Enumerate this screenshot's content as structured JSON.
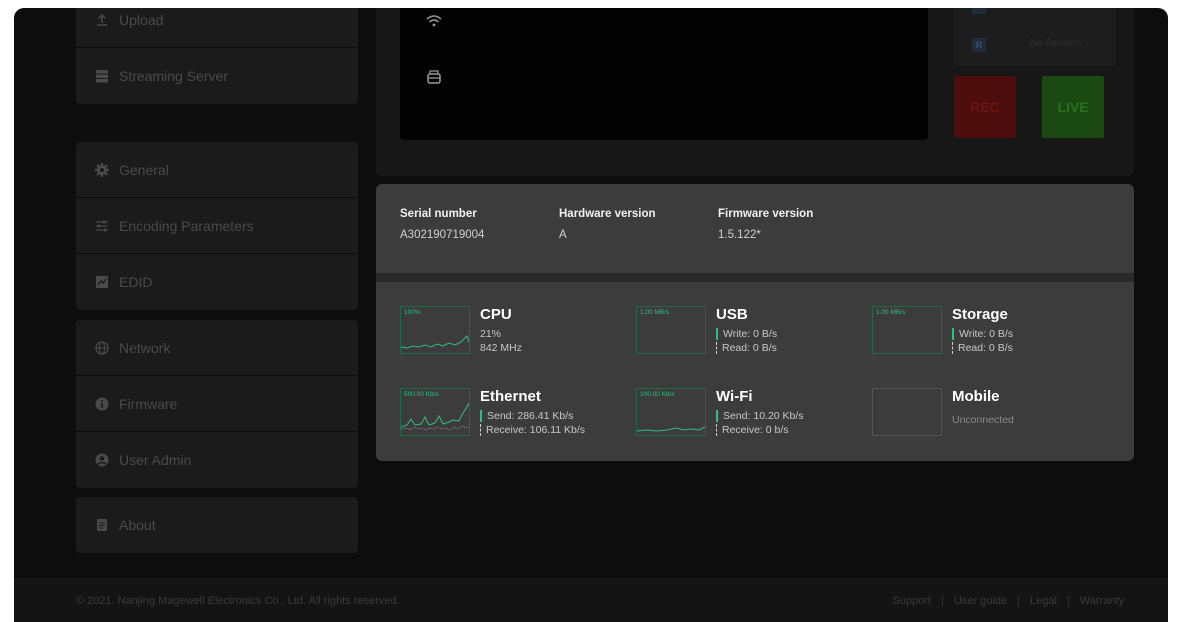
{
  "sidebar": {
    "group1": [
      {
        "label": "Upload",
        "icon": "upload-icon"
      },
      {
        "label": "Streaming Server",
        "icon": "server-icon"
      }
    ],
    "group2": [
      {
        "label": "General",
        "icon": "gear-icon"
      },
      {
        "label": "Encoding Parameters",
        "icon": "sliders-icon"
      },
      {
        "label": "EDID",
        "icon": "edid-icon"
      }
    ],
    "group3": [
      {
        "label": "Network",
        "icon": "globe-icon"
      },
      {
        "label": "Firmware",
        "icon": "info-icon"
      },
      {
        "label": "User Admin",
        "icon": "user-icon"
      }
    ],
    "group4": [
      {
        "label": "About",
        "icon": "document-icon"
      }
    ]
  },
  "top": {
    "no_session": "No Session",
    "rec_badge": "R",
    "rec_label": "REC",
    "live_label": "LIVE"
  },
  "device_info": {
    "serial": {
      "label": "Serial number",
      "value": "A302190719004"
    },
    "hardware": {
      "label": "Hardware version",
      "value": "A"
    },
    "firmware": {
      "label": "Firmware version",
      "value": "1.5.122*"
    }
  },
  "stats": {
    "cpu": {
      "title": "CPU",
      "scale": "100%",
      "usage": "21%",
      "freq": "842 MHz"
    },
    "usb": {
      "title": "USB",
      "scale": "1.00 MB/s",
      "write": "Write: 0 B/s",
      "read": "Read: 0 B/s"
    },
    "storage": {
      "title": "Storage",
      "scale": "1.00 MB/s",
      "write": "Write: 0 B/s",
      "read": "Read: 0 B/s"
    },
    "ethernet": {
      "title": "Ethernet",
      "scale": "500.00 Kb/s",
      "send": "Send: 286.41 Kb/s",
      "receive": "Receive: 106.11 Kb/s"
    },
    "wifi": {
      "title": "Wi-Fi",
      "scale": "100.00 Kb/s",
      "send": "Send: 10.20 Kb/s",
      "receive": "Receive: 0 b/s"
    },
    "mobile": {
      "title": "Mobile",
      "status": "Unconnected"
    }
  },
  "colors": {
    "graph_green": "#2fbf7f",
    "panel": "#3c3c3c",
    "background": "#0d0d0d"
  },
  "footer": {
    "copyright": "© 2021. Nanjing Magewell Electronics Co., Ltd. All rights reserved.",
    "links": [
      "Support",
      "User guide",
      "Legal",
      "Warranty"
    ]
  }
}
